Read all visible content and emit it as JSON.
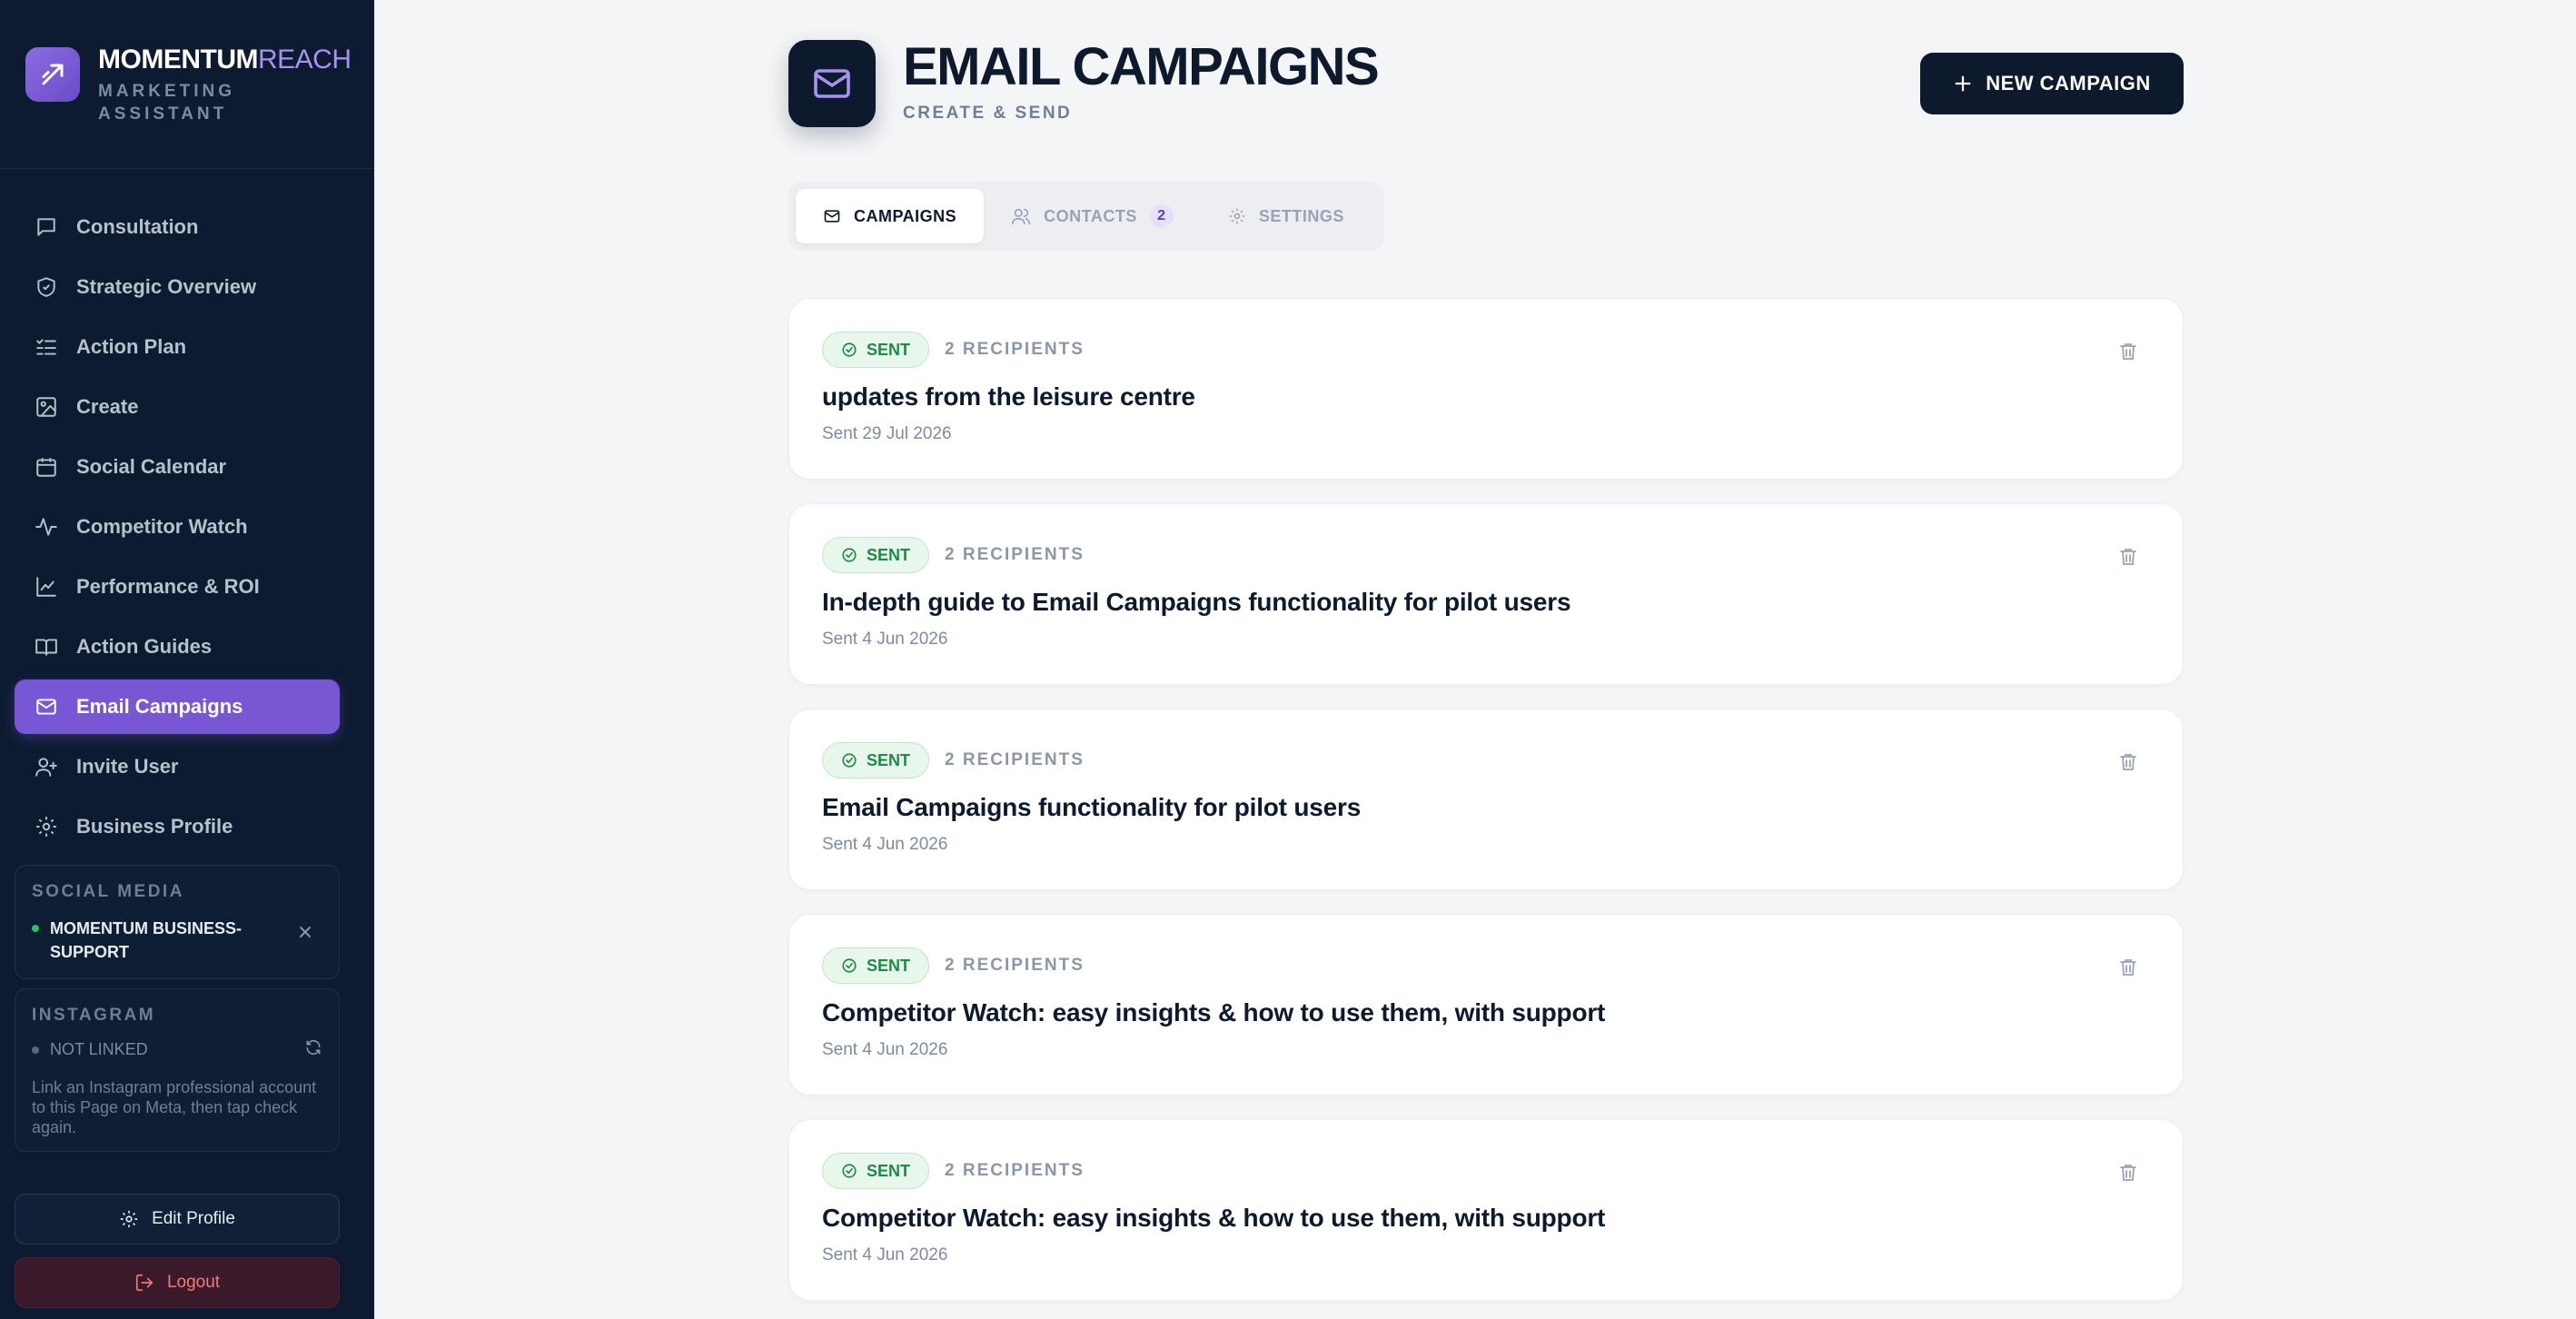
{
  "brand": {
    "name_main": "MOMENTUM",
    "name_accent": "REACH",
    "subtitle": "MARKETING ASSISTANT"
  },
  "nav": {
    "items": [
      {
        "label": "Consultation",
        "icon": "chat-icon"
      },
      {
        "label": "Strategic Overview",
        "icon": "shield-icon"
      },
      {
        "label": "Action Plan",
        "icon": "checklist-icon"
      },
      {
        "label": "Create",
        "icon": "image-icon"
      },
      {
        "label": "Social Calendar",
        "icon": "calendar-icon"
      },
      {
        "label": "Competitor Watch",
        "icon": "pulse-icon"
      },
      {
        "label": "Performance & ROI",
        "icon": "chart-icon"
      },
      {
        "label": "Action Guides",
        "icon": "book-icon"
      },
      {
        "label": "Email Campaigns",
        "icon": "mail-icon",
        "active": true
      },
      {
        "label": "Invite User",
        "icon": "user-plus-icon"
      },
      {
        "label": "Business Profile",
        "icon": "gear-icon"
      }
    ]
  },
  "social_media": {
    "title": "SOCIAL MEDIA",
    "account": "MOMENTUM BUSINESS-SUPPORT",
    "status_color": "#22c55e"
  },
  "instagram": {
    "title": "INSTAGRAM",
    "status": "NOT LINKED",
    "note": "Link an Instagram professional account to this Page on Meta, then tap check again."
  },
  "footer": {
    "edit_label": "Edit Profile",
    "logout_label": "Logout"
  },
  "header": {
    "title": "EMAIL CAMPAIGNS",
    "subtitle": "CREATE & SEND",
    "new_label": "NEW CAMPAIGN"
  },
  "tabs": {
    "campaigns": "CAMPAIGNS",
    "contacts": "CONTACTS",
    "contacts_count": "2",
    "settings": "SETTINGS"
  },
  "campaigns": [
    {
      "status": "SENT",
      "recipients": "2 RECIPIENTS",
      "title": "updates from the leisure centre",
      "date": "Sent 29 Jul 2026"
    },
    {
      "status": "SENT",
      "recipients": "2 RECIPIENTS",
      "title": "In-depth guide to Email Campaigns functionality for pilot users",
      "date": "Sent 4 Jun 2026"
    },
    {
      "status": "SENT",
      "recipients": "2 RECIPIENTS",
      "title": "Email Campaigns functionality for pilot users",
      "date": "Sent 4 Jun 2026"
    },
    {
      "status": "SENT",
      "recipients": "2 RECIPIENTS",
      "title": "Competitor Watch: easy insights & how to use them, with support",
      "date": "Sent 4 Jun 2026"
    },
    {
      "status": "SENT",
      "recipients": "2 RECIPIENTS",
      "title": "Competitor Watch: easy insights & how to use them, with support",
      "date": "Sent 4 Jun 2026"
    }
  ],
  "colors": {
    "sidebar_bg": "#0c1b30",
    "accent": "#7857d4",
    "dark": "#0d1a2e",
    "sent_green": "#1f8a45"
  }
}
